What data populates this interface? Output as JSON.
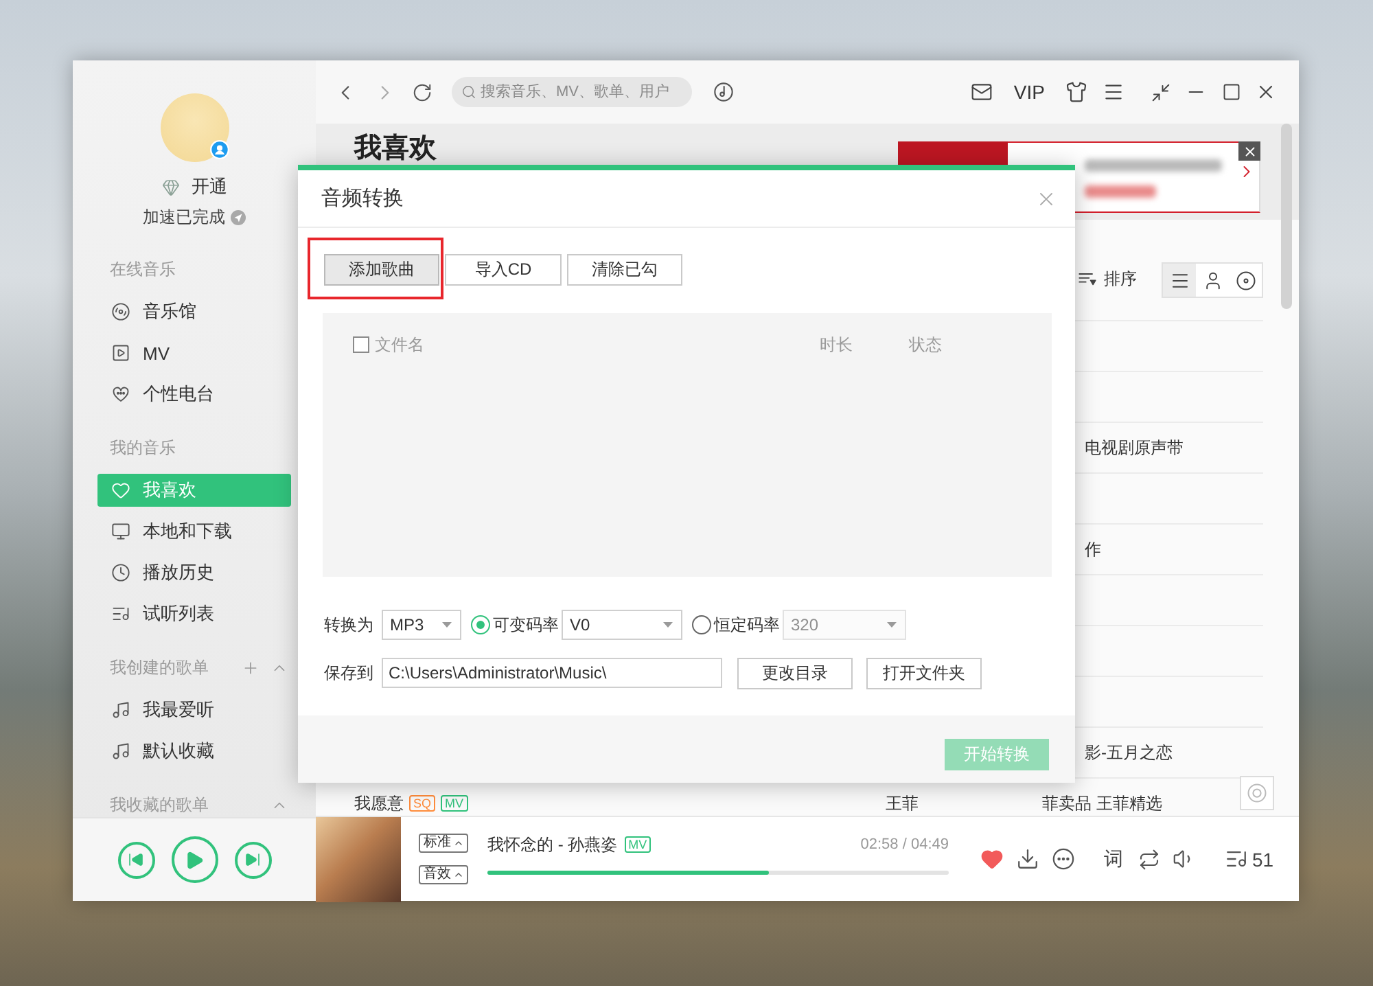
{
  "sidebar": {
    "user": {
      "vip_label": "开通",
      "status": "加速已完成"
    },
    "sections": [
      {
        "title": "在线音乐",
        "items": [
          {
            "label": "音乐馆",
            "kind": "hall",
            "selected": false
          },
          {
            "label": "MV",
            "kind": "video",
            "selected": false
          },
          {
            "label": "个性电台",
            "kind": "radio",
            "selected": false
          }
        ]
      },
      {
        "title": "我的音乐",
        "items": [
          {
            "label": "我喜欢",
            "kind": "heart",
            "selected": true
          },
          {
            "label": "本地和下载",
            "kind": "computer",
            "selected": false
          },
          {
            "label": "播放历史",
            "kind": "history",
            "selected": false
          },
          {
            "label": "试听列表",
            "kind": "queue",
            "selected": false
          }
        ]
      },
      {
        "title": "我创建的歌单",
        "add_button": true,
        "expanded": true,
        "items": [
          {
            "label": "我最爱听",
            "kind": "note",
            "selected": false
          },
          {
            "label": "默认收藏",
            "kind": "note",
            "selected": false
          }
        ]
      },
      {
        "title": "我收藏的歌单",
        "expanded": true
      }
    ],
    "controls": {
      "playing": false
    }
  },
  "top_bar": {
    "search": {
      "placeholder": "搜索音乐、MV、歌单、用户"
    },
    "vip_label": "VIP"
  },
  "page": {
    "title": "我喜欢",
    "sort_label": "排序",
    "views": [
      {
        "kind": "list",
        "selected": true
      },
      {
        "kind": "singer",
        "selected": false
      },
      {
        "kind": "album",
        "selected": false
      }
    ],
    "rows": [
      {},
      {},
      {
        "album": "电视剧原声带"
      },
      {},
      {
        "album": "作"
      },
      {},
      {},
      {},
      {
        "album": "影-五月之恋"
      },
      {
        "title": "我愿意",
        "badges": [
          {
            "label": "SQ",
            "color": "#ff8c3c"
          },
          {
            "label": "MV",
            "color": "#31c27c"
          }
        ],
        "singer": "王菲",
        "album": "菲卖品 王菲精选"
      }
    ]
  },
  "dialog": {
    "title": "音频转换",
    "actions": [
      {
        "label": "添加歌曲",
        "pressed": true,
        "highlighted": true
      },
      {
        "label": "导入CD",
        "pressed": false,
        "highlighted": false
      },
      {
        "label": "清除已勾",
        "pressed": false,
        "highlighted": false
      }
    ],
    "file_list": {
      "select_all_checked": false,
      "columns": [
        "文件名",
        "时长",
        "状态"
      ]
    },
    "format": {
      "label": "转换为",
      "value": "MP3",
      "modes": [
        {
          "label": "可变码率",
          "selected": true,
          "value": "V0"
        },
        {
          "label": "恒定码率",
          "selected": false,
          "value": "320"
        }
      ]
    },
    "save": {
      "label": "保存到",
      "path": "C:\\Users\\Administrator\\Music\\",
      "buttons": [
        "更改目录",
        "打开文件夹"
      ]
    },
    "start_button": {
      "label": "开始转换",
      "disabled": true
    }
  },
  "player": {
    "quality": "标准",
    "effect": "音效",
    "title": "我怀念的 - 孙燕姿",
    "mv_badge": "MV",
    "time": "02:58 / 04:49",
    "level": 0.61,
    "liked": true,
    "lyrics_label": "词",
    "playlist_count": "51"
  }
}
